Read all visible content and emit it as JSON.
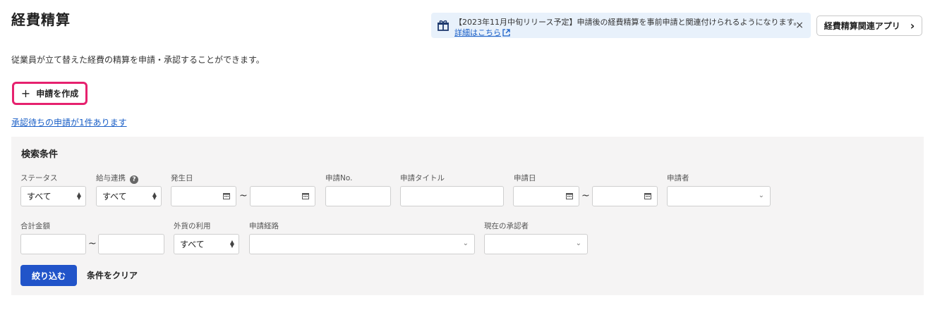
{
  "page": {
    "title": "経費精算",
    "description": "従業員が立て替えた経費の精算を申請・承認することができます。"
  },
  "notice": {
    "message": "【2023年11月中旬リリース予定】申請後の経費精算を事前申請と関連付けられるようになります。",
    "link": "詳細はこちら",
    "close": "×"
  },
  "related_app_button": {
    "label": "経費精算関連アプリ",
    "chevron": "›"
  },
  "create_button": {
    "plus": "+",
    "label": "申請を作成"
  },
  "pending_link": "承認待ちの申請が1件あります",
  "search": {
    "title": "検索条件",
    "tilde": "~",
    "fields": {
      "status": {
        "label": "ステータス",
        "value": "すべて"
      },
      "payroll": {
        "label": "給与連携",
        "help": "?",
        "value": "すべて"
      },
      "occurred_date": {
        "label": "発生日",
        "from": "",
        "to": ""
      },
      "application_no": {
        "label": "申請No.",
        "value": ""
      },
      "application_title": {
        "label": "申請タイトル",
        "value": ""
      },
      "application_date": {
        "label": "申請日",
        "from": "",
        "to": ""
      },
      "applicant": {
        "label": "申請者",
        "value": ""
      },
      "total_amount": {
        "label": "合計金額",
        "from": "",
        "to": ""
      },
      "foreign_currency": {
        "label": "外貨の利用",
        "value": "すべて"
      },
      "route": {
        "label": "申請経路",
        "value": ""
      },
      "current_approver": {
        "label": "現在の承認者",
        "value": ""
      }
    },
    "filter_button": "絞り込む",
    "clear_button": "条件をクリア"
  },
  "colors": {
    "accent_blue": "#2154c9",
    "highlight_pink": "#e6216e",
    "notice_bg": "#e8f1fb",
    "panel_bg": "#f5f4f4"
  }
}
